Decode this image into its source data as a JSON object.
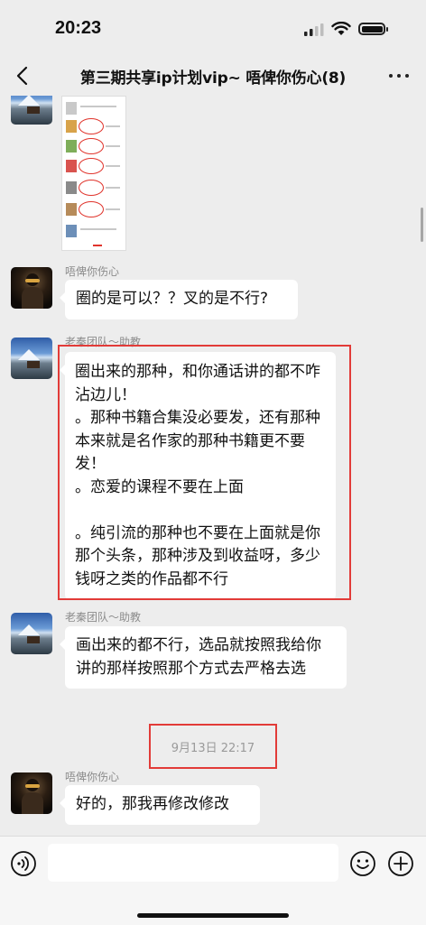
{
  "status_bar": {
    "time": "20:23"
  },
  "nav": {
    "title": "第三期共享ip计划vip~ 唔俾你伤心(8)"
  },
  "messages": [
    {
      "type": "image",
      "sender": "老秦团队～助教"
    },
    {
      "type": "text",
      "sender": "唔俾你伤心",
      "text": "圈的是可以？？叉的是不行?"
    },
    {
      "type": "text",
      "sender": "老秦团队～助教",
      "text": "圈出来的那种，和你通话讲的都不咋沾边儿！\n。那种书籍合集没必要发，还有那种本来就是名作家的那种书籍更不要发！\n。恋爱的课程不要在上面\n\n。纯引流的那种也不要在上面就是你那个头条，那种涉及到收益呀，多少钱呀之类的作品都不行"
    },
    {
      "type": "text",
      "sender": "老秦团队～助教",
      "text": "画出来的都不行，选品就按照我给你讲的那样按照那个方式去严格去选"
    },
    {
      "type": "timestamp",
      "text": "9月13日 22:17"
    },
    {
      "type": "text",
      "sender": "唔俾你伤心",
      "text": "好的，那我再修改修改"
    }
  ],
  "input": {
    "value": "",
    "placeholder": ""
  },
  "icons": [
    "back-icon",
    "more-icon",
    "voice-icon",
    "emoji-icon",
    "plus-icon",
    "signal-icon",
    "wifi-icon",
    "battery-icon"
  ],
  "colors": {
    "background": "#ededed",
    "bubble": "#ffffff",
    "highlight_box": "#e23b38"
  }
}
